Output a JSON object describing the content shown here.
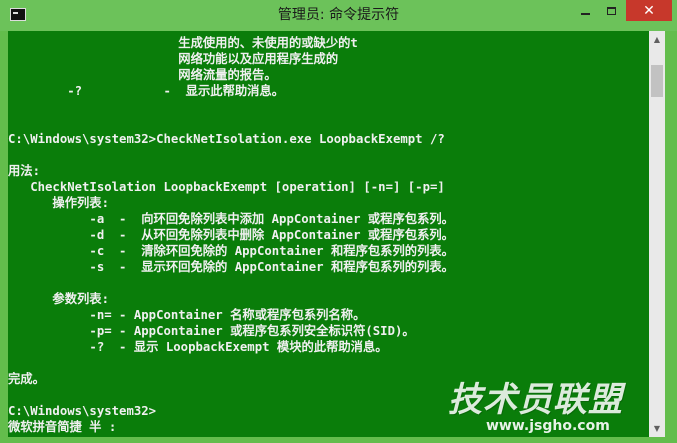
{
  "window": {
    "title": "管理员: 命令提示符",
    "icon": "cmd-icon",
    "buttons": {
      "minimize": "minimize-icon",
      "maximize": "maximize-icon",
      "close": "✕"
    }
  },
  "console": {
    "background": "#0a7d0a",
    "foreground": "#f0f0f0",
    "lines": [
      "                       生成使用的、未使用的或缺少的t",
      "                       网络功能以及应用程序生成的",
      "                       网络流量的报告。",
      "        -?           -  显示此帮助消息。",
      "",
      "",
      "C:\\Windows\\system32>CheckNetIsolation.exe LoopbackExempt /?",
      "",
      "用法:",
      "   CheckNetIsolation LoopbackExempt [operation] [-n=] [-p=]",
      "      操作列表:",
      "           -a  -  向环回免除列表中添加 AppContainer 或程序包系列。",
      "           -d  -  从环回免除列表中删除 AppContainer 或程序包系列。",
      "           -c  -  清除环回免除的 AppContainer 和程序包系列的列表。",
      "           -s  -  显示环回免除的 AppContainer 和程序包系列的列表。",
      "",
      "      参数列表:",
      "           -n= - AppContainer 名称或程序包系列名称。",
      "           -p= - AppContainer 或程序包系列安全标识符(SID)。",
      "           -?  - 显示 LoopbackExempt 模块的此帮助消息。",
      "",
      "完成。",
      "",
      "C:\\Windows\\system32>",
      "微软拼音简捷 半 :"
    ]
  },
  "scrollbar": {
    "up": "▲",
    "down": "▼",
    "position": 0.08
  },
  "watermark": {
    "logo": "技术员联盟",
    "url": "www.jsgho.com"
  }
}
